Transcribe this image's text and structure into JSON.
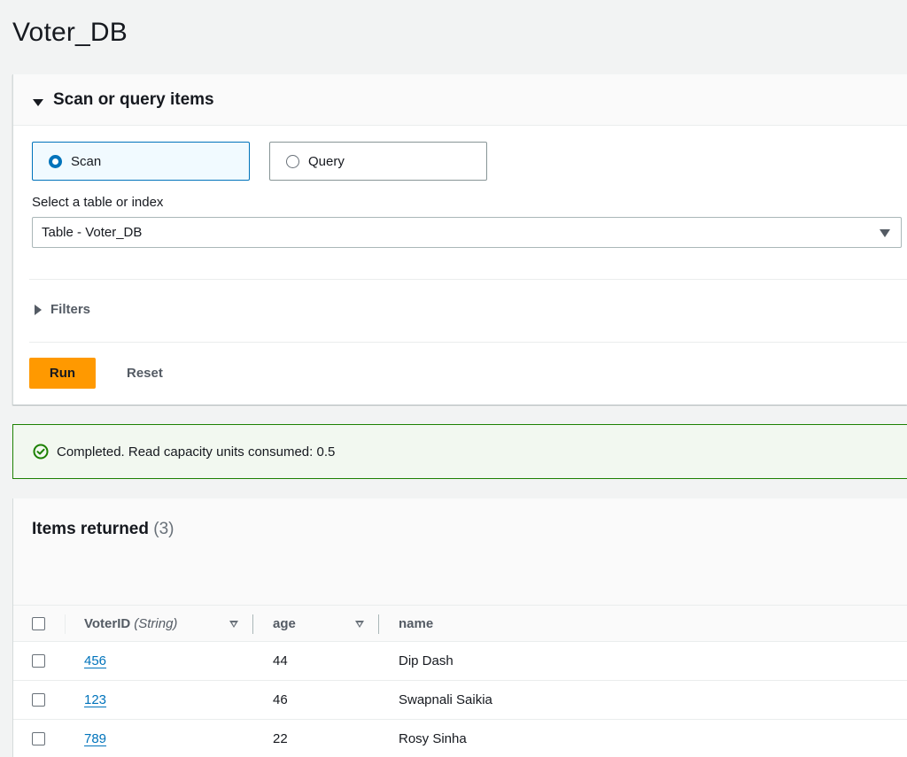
{
  "page": {
    "title": "Voter_DB"
  },
  "scan_panel": {
    "title": "Scan or query items",
    "mode_options": [
      {
        "label": "Scan",
        "selected": true
      },
      {
        "label": "Query",
        "selected": false
      }
    ],
    "select_label": "Select a table or index",
    "select_value": "Table - Voter_DB",
    "filters_label": "Filters",
    "run_label": "Run",
    "reset_label": "Reset"
  },
  "alert": {
    "status": "success",
    "message": "Completed. Read capacity units consumed: 0.5"
  },
  "results": {
    "title": "Items returned",
    "count": "(3)",
    "columns": [
      {
        "name": "VoterID",
        "type_hint": "(String)"
      },
      {
        "name": "age"
      },
      {
        "name": "name"
      }
    ],
    "rows": [
      {
        "VoterID": "456",
        "age": "44",
        "name": "Dip Dash"
      },
      {
        "VoterID": "123",
        "age": "46",
        "name": "Swapnali Saikia"
      },
      {
        "VoterID": "789",
        "age": "22",
        "name": "Rosy Sinha"
      }
    ]
  },
  "colors": {
    "accent": "#0073bb",
    "primary_button": "#ff9900",
    "success": "#1d8102"
  }
}
